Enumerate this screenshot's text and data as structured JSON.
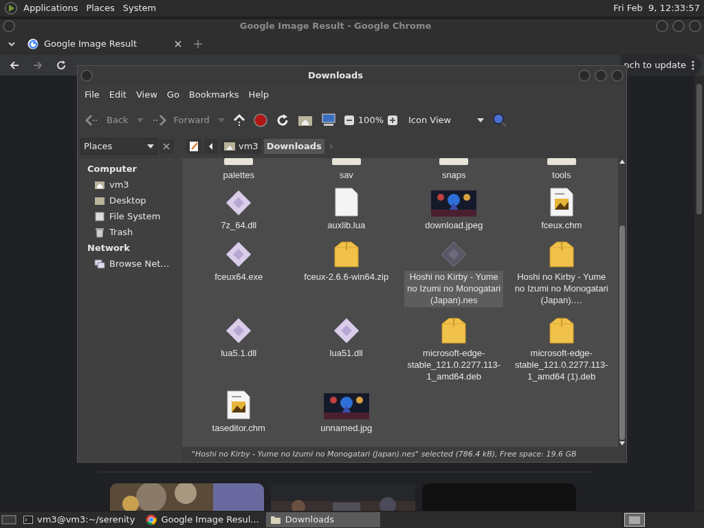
{
  "top_panel": {
    "menus": [
      "Applications",
      "Places",
      "System"
    ],
    "clock": "Fri Feb  9, 12:33:57"
  },
  "chrome": {
    "title": "Google Image Result - Google Chrome",
    "tab": {
      "label": "Google Image Result"
    },
    "update_button": "nch to update"
  },
  "file_manager": {
    "title": "Downloads",
    "menu": [
      "File",
      "Edit",
      "View",
      "Go",
      "Bookmarks",
      "Help"
    ],
    "toolbar": {
      "back": "Back",
      "forward": "Forward",
      "zoom": "100%",
      "view": "Icon View"
    },
    "sidebar": {
      "selector": "Places",
      "sections": [
        {
          "title": "Computer",
          "items": [
            {
              "label": "vm3",
              "kind": "home"
            },
            {
              "label": "Desktop",
              "kind": "desktop"
            },
            {
              "label": "File System",
              "kind": "drive"
            },
            {
              "label": "Trash",
              "kind": "trash"
            }
          ]
        },
        {
          "title": "Network",
          "items": [
            {
              "label": "Browse Net…",
              "kind": "network"
            }
          ]
        }
      ]
    },
    "path": [
      {
        "label": "vm3",
        "selected": false
      },
      {
        "label": "Downloads",
        "selected": true
      }
    ],
    "files": [
      {
        "name": "palettes",
        "kind": "folder",
        "selected": false
      },
      {
        "name": "sav",
        "kind": "folder",
        "selected": false
      },
      {
        "name": "snaps",
        "kind": "folder",
        "selected": false
      },
      {
        "name": "tools",
        "kind": "folder",
        "selected": false
      },
      {
        "name": "7z_64.dll",
        "kind": "library",
        "selected": false
      },
      {
        "name": "auxlib.lua",
        "kind": "text",
        "selected": false
      },
      {
        "name": "download.jpeg",
        "selected": false
      },
      {
        "name": "fceux.chm",
        "kind": "help",
        "selected": false
      },
      {
        "name": "fceux64.exe",
        "kind": "library",
        "selected": false
      },
      {
        "name": "fceux-2.6.6-win64.zip",
        "kind": "archive",
        "selected": false
      },
      {
        "name": "Hoshi no Kirby - Yume no Izumi no Monogatari (Japan).nes",
        "kind": "rom",
        "selected": true
      },
      {
        "name": "Hoshi no Kirby - Yume no Izumi no Monogatari (Japan).…",
        "kind": "archive",
        "selected": false
      },
      {
        "name": "lua5.1.dll",
        "kind": "library",
        "selected": false
      },
      {
        "name": "lua51.dll",
        "kind": "library",
        "selected": false
      },
      {
        "name": "microsoft-edge-stable_121.0.2277.113-1_amd64.deb",
        "kind": "archive",
        "selected": false
      },
      {
        "name": "microsoft-edge-stable_121.0.2277.113-1_amd64 (1).deb",
        "kind": "archive",
        "selected": false
      },
      {
        "name": "taseditor.chm",
        "kind": "help",
        "selected": false
      },
      {
        "name": "unnamed.jpg",
        "selected": false
      }
    ],
    "status": "\"Hoshi no Kirby - Yume no Izumi no Monogatari (Japan).nes\" selected (786.4 kB), Free space: 19.6 GB"
  },
  "taskbar": [
    {
      "label": "vm3@vm3:~/serenity",
      "kind": "terminal",
      "selected": false
    },
    {
      "label": "Google Image Resul...",
      "kind": "browser",
      "selected": false
    },
    {
      "label": "Downloads",
      "kind": "folder",
      "selected": true
    }
  ]
}
